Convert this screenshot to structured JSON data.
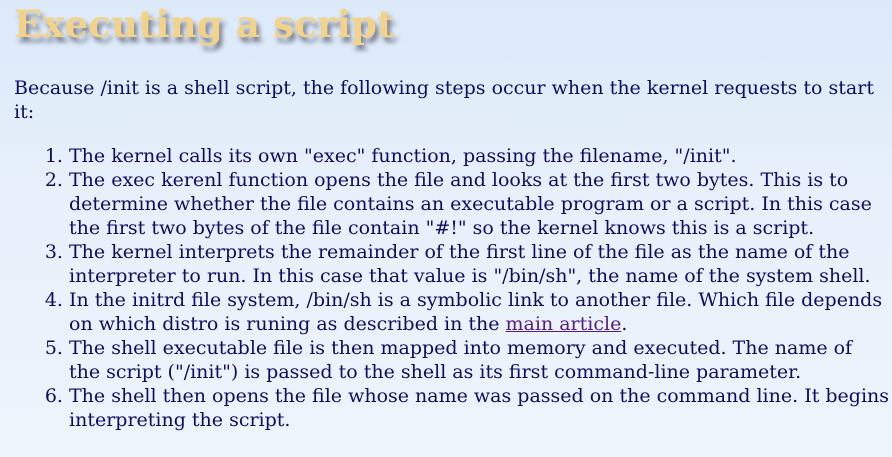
{
  "heading": "Executing a script",
  "intro": "Because /init is a shell script, the following steps occur when the kernel requests to start it:",
  "steps": [
    {
      "text": "The kernel calls its own \"exec\" function, passing the filename, \"/init\"."
    },
    {
      "text": "The exec kerenl function opens the file and looks at the first two bytes. This is to determine whether the file contains an executable program or a script. In this case the first two bytes of the file contain \"#!\" so the kernel knows this is a script."
    },
    {
      "text": "The kernel interprets the remainder of the first line of the file as the name of the interpreter to run. In this case that value is \"/bin/sh\", the name of the system shell."
    },
    {
      "text_before": "In the initrd file system, /bin/sh is a symbolic link to another file. Which file depends on which distro is runing as described in the ",
      "link_text": "main article",
      "text_after": "."
    },
    {
      "text": "The shell executable file is then mapped into memory and executed. The name of the script (\"/init\") is passed to the shell as its first command-line parameter."
    },
    {
      "text": "The shell then opens the file whose name was passed on the command line. It begins interpreting the script."
    }
  ]
}
